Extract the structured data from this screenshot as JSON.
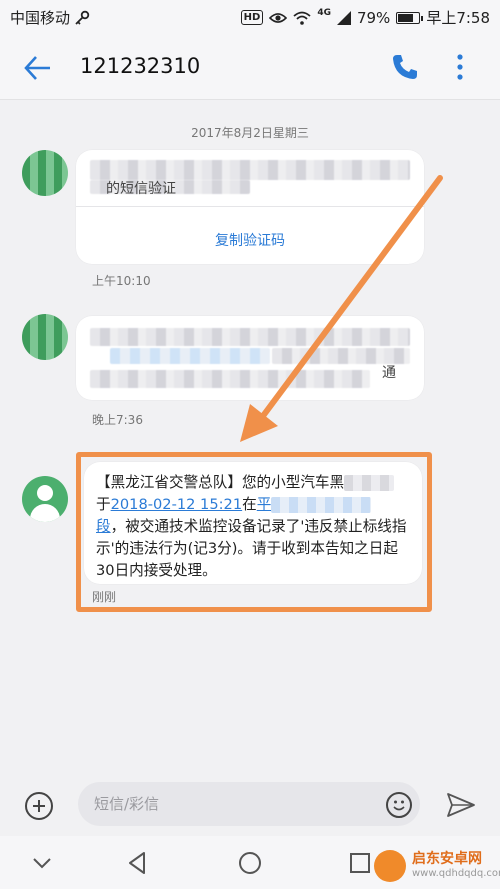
{
  "status_bar": {
    "carrier": "中国移动",
    "hd": "HD",
    "network": "4G",
    "battery": "79%",
    "battery_level": 0.79,
    "time": "早上7:58"
  },
  "header": {
    "contact_number": "121232310"
  },
  "thread": {
    "date_separator": "2017年8月2日星期三",
    "messages": [
      {
        "visible_text": "的短信验证",
        "copy_code_label": "复制验证码",
        "time": "上午10:10"
      },
      {
        "visible_text": "通",
        "time": "晚上7:36"
      },
      {
        "sender_tag": "【黑龙江省交警总队】",
        "text_1": "您的小型汽车黑",
        "text_2": "于",
        "link_datetime": "2018-02-12 15:21",
        "text_3": "在",
        "link_place_1": "平",
        "link_place_2": "段",
        "text_4": "，被交通技术监控设备记录了'违反禁止标线指示'的违法行为(记3分)。请于收到本告知之日起30日内接受处理。",
        "time": "刚刚"
      }
    ]
  },
  "composer": {
    "placeholder": "短信/彩信"
  },
  "watermark": {
    "name": "启东安卓网",
    "url": "www.qdhdqdq.com"
  },
  "colors": {
    "accent": "#2b7bd6",
    "avatar": "#4caf6e",
    "highlight_box": "#f0904a",
    "arrow": "#f0904a"
  }
}
